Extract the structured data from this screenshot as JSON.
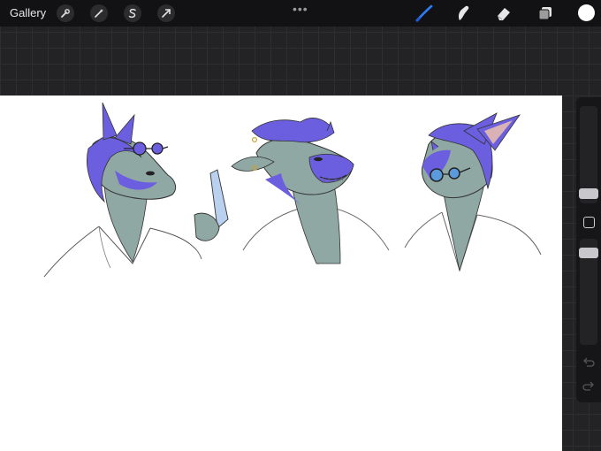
{
  "topbar": {
    "gallery_label": "Gallery",
    "left_tools": [
      "wrench-icon",
      "magic-wand-icon",
      "selection-s-icon",
      "transform-arrow-icon"
    ],
    "more_menu": "•••",
    "right_tools": [
      "brush-icon",
      "smudge-icon",
      "eraser-icon",
      "layers-icon"
    ],
    "active_tool": "brush-icon",
    "active_color": "#ffffff"
  },
  "sidebar": {
    "controls": [
      "brush-size-slider",
      "modify-button",
      "opacity-slider",
      "undo-icon",
      "redo-icon"
    ]
  },
  "colors": {
    "accent": "#2f7bf6",
    "character_blue": "#6b5fe0",
    "character_teal": "#8fa8a3"
  }
}
